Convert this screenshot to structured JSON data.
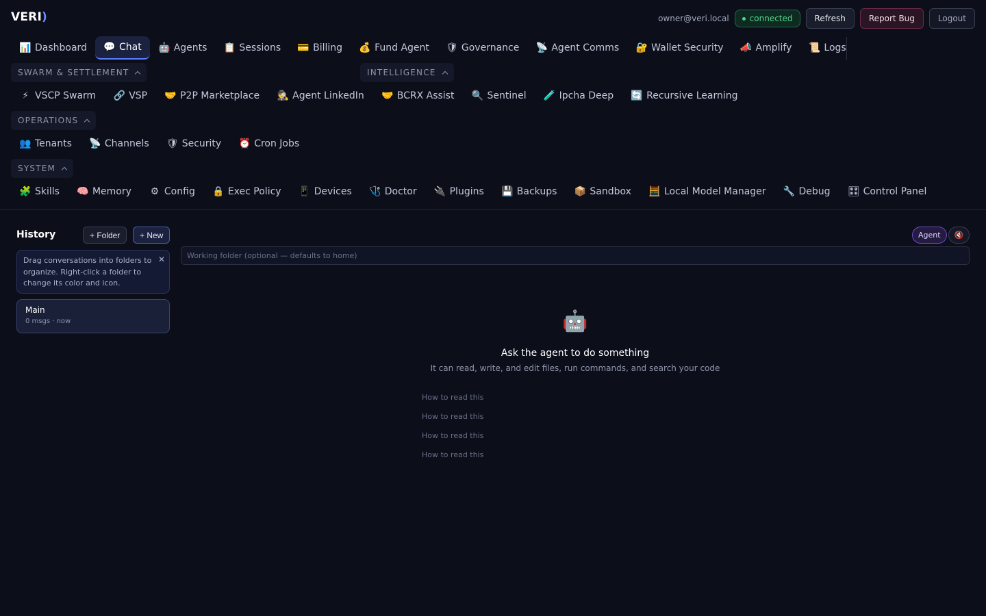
{
  "app": {
    "logo": "VERI",
    "logo_accent": ")",
    "user_email": "owner@veri.local",
    "connection_status": "connected",
    "buttons": {
      "refresh": "Refresh",
      "report_bug": "Report Bug",
      "logout": "Logout"
    }
  },
  "nav_primary": [
    {
      "icon": "📊",
      "label": "Dashboard"
    },
    {
      "icon": "💬",
      "label": "Chat",
      "active": true
    },
    {
      "icon": "🤖",
      "label": "Agents"
    },
    {
      "icon": "📋",
      "label": "Sessions"
    },
    {
      "icon": "💳",
      "label": "Billing"
    },
    {
      "icon": "💰",
      "label": "Fund Agent"
    },
    {
      "icon": "🛡",
      "label": "Governance"
    },
    {
      "icon": "📡",
      "label": "Agent Comms"
    },
    {
      "icon": "🔐",
      "label": "Wallet Security"
    },
    {
      "icon": "📣",
      "label": "Amplify"
    },
    {
      "icon": "📜",
      "label": "Logs"
    }
  ],
  "sections": {
    "swarm": "SWARM & SETTLEMENT",
    "intelligence": "INTELLIGENCE",
    "operations": "OPERATIONS",
    "system": "SYSTEM"
  },
  "nav_swarm": [
    {
      "icon": "⚡",
      "label": "VSCP Swarm"
    },
    {
      "icon": "🔗",
      "label": "VSP"
    },
    {
      "icon": "🤝",
      "label": "P2P Marketplace"
    },
    {
      "icon": "🕵",
      "label": "Agent LinkedIn"
    },
    {
      "icon": "🤝",
      "label": "BCRX Assist"
    },
    {
      "icon": "🔍",
      "label": "Sentinel"
    },
    {
      "icon": "🧪",
      "label": "Ipcha Deep"
    },
    {
      "icon": "🔄",
      "label": "Recursive Learning"
    }
  ],
  "nav_operations": [
    {
      "icon": "👥",
      "label": "Tenants"
    },
    {
      "icon": "📡",
      "label": "Channels"
    },
    {
      "icon": "🛡",
      "label": "Security"
    },
    {
      "icon": "⏰",
      "label": "Cron Jobs"
    }
  ],
  "nav_system": [
    {
      "icon": "🧩",
      "label": "Skills"
    },
    {
      "icon": "🧠",
      "label": "Memory"
    },
    {
      "icon": "⚙",
      "label": "Config"
    },
    {
      "icon": "🔒",
      "label": "Exec Policy"
    },
    {
      "icon": "📱",
      "label": "Devices"
    },
    {
      "icon": "🩺",
      "label": "Doctor"
    },
    {
      "icon": "🔌",
      "label": "Plugins"
    },
    {
      "icon": "💾",
      "label": "Backups"
    },
    {
      "icon": "📦",
      "label": "Sandbox"
    },
    {
      "icon": "🧮",
      "label": "Local Model Manager"
    },
    {
      "icon": "🔧",
      "label": "Debug"
    },
    {
      "icon": "🎛",
      "label": "Control Panel"
    }
  ],
  "history": {
    "title": "History",
    "folder_button": "+ Folder",
    "new_button": "+ New",
    "tip": "Drag conversations into folders to organize. Right-click a folder to change its color and icon.",
    "conversations": [
      {
        "title": "Main",
        "meta": "0 msgs · now"
      }
    ]
  },
  "main": {
    "mode_label": "Agent",
    "folder_placeholder": "Working folder (optional — defaults to home)",
    "empty_icon": "🤖",
    "empty_title": "Ask the agent to do something",
    "empty_subtitle": "It can read, write, and edit files, run commands, and search your code",
    "suggestions": [
      "How to read this",
      "How to read this",
      "How to read this",
      "How to read this"
    ]
  }
}
